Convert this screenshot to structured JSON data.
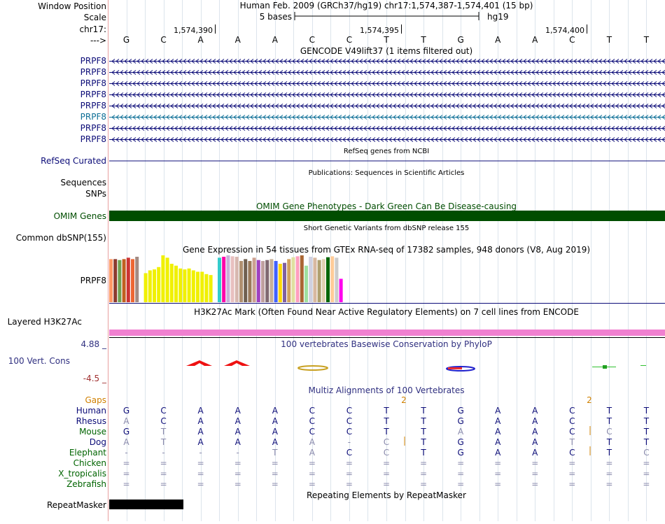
{
  "header": {
    "window_position_label": "Window Position",
    "scale_label": "Scale",
    "chrom_label": "chr17:",
    "strand_label": "--->",
    "assembly_text": "Human Feb. 2009 (GRCh37/hg19)   chr17:1,574,387-1,574,401 (15 bp)",
    "scale_text": "5 bases",
    "db_text": "hg19",
    "positions": [
      "1,574,390",
      "1,574,395",
      "1,574,400"
    ],
    "bases": [
      "G",
      "C",
      "A",
      "A",
      "A",
      "C",
      "C",
      "T",
      "T",
      "G",
      "A",
      "A",
      "C",
      "T",
      "T"
    ]
  },
  "gencode": {
    "title": "GENCODE V49lift37 (1 items filtered out)",
    "labels": [
      "PRPF8",
      "PRPF8",
      "PRPF8",
      "PRPF8",
      "PRPF8",
      "PRPF8",
      "PRPF8",
      "PRPF8"
    ],
    "colors": [
      "#0c0c78",
      "#0c0c78",
      "#0c0c78",
      "#0c0c78",
      "#0c0c78",
      "#0c6e96",
      "#0c0c78",
      "#0c0c78"
    ]
  },
  "refseq": {
    "title": "RefSeq genes from NCBI",
    "label": "RefSeq Curated",
    "color": "#0c0c78"
  },
  "publications": {
    "title": "Publications: Sequences in Scientific Articles",
    "label_sequences": "Sequences",
    "label_snps": "SNPs"
  },
  "omim": {
    "title": "OMIM Gene Phenotypes - Dark Green Can Be Disease-causing",
    "label": "OMIM Genes",
    "color": "#004d00"
  },
  "dbsnp": {
    "title": "Short Genetic Variants from dbSNP release 155",
    "label": "Common dbSNP(155)"
  },
  "gtex": {
    "title": "Gene Expression in 54 tissues from GTEx RNA-seq of 17382 samples, 948 donors (V8, Aug 2019)",
    "label": "PRPF8",
    "values": [
      0.92,
      0.92,
      0.9,
      0.92,
      0.95,
      0.92,
      0.97,
      0.95,
      0.62,
      0.68,
      0.7,
      0.75,
      1.0,
      0.95,
      0.82,
      0.78,
      0.72,
      0.7,
      0.72,
      0.68,
      0.65,
      0.65,
      0.6,
      0.58,
      0.62,
      0.95,
      0.97,
      1.0,
      0.98,
      0.97,
      0.88,
      0.92,
      0.88,
      0.95,
      0.9,
      0.88,
      0.9,
      0.92,
      0.88,
      0.82,
      0.84,
      0.92,
      0.96,
      0.98,
      1.0,
      0.78,
      0.97,
      0.95,
      0.9,
      0.92,
      0.96,
      0.98,
      0.95,
      0.5
    ],
    "colors": [
      "#ff9966",
      "#8c3a2e",
      "#70a050",
      "#c06020",
      "#cc3333",
      "#ee6633",
      "#a48a82",
      "#ffffff",
      "#f0f000",
      "#f0f000",
      "#f0f000",
      "#f0f000",
      "#f0f000",
      "#f0f000",
      "#f0f000",
      "#f0f000",
      "#f0f000",
      "#f0f000",
      "#f0f000",
      "#f0f000",
      "#f0f000",
      "#f0f000",
      "#f0f000",
      "#f0f000",
      "#ffffff",
      "#33cccc",
      "#ff00aa",
      "#c8b0d8",
      "#e8c0c0",
      "#d8b8b0",
      "#b09070",
      "#706050",
      "#9a7a5a",
      "#cca090",
      "#a040c0",
      "#c0a0a0",
      "#806870",
      "#c8b098",
      "#4060ff",
      "#ffd700",
      "#8060a0",
      "#d0a060",
      "#e0e0a0",
      "#ff9fbf",
      "#aa6633",
      "#a0e0a0",
      "#d0d0e0",
      "#d8b8a0",
      "#b0a070",
      "#e0d0b0",
      "#006400",
      "#ffcc99",
      "#cccccc",
      "#ff00ee"
    ]
  },
  "h3k27ac": {
    "title": "H3K27Ac Mark (Often Found Near Active Regulatory Elements) on 7 cell lines from ENCODE",
    "label": "Layered H3K27Ac",
    "color": "#f080d0"
  },
  "conservation": {
    "title": "100 vertebrates Basewise Conservation by PhyloP",
    "label": "100 Vert. Cons",
    "max_label": "4.88 _",
    "min_label": "-4.5 _"
  },
  "multiz": {
    "title": "Multiz Alignments of 100 Vertebrates",
    "gaps_label": "Gaps",
    "gap_markers": [
      "2",
      "2"
    ],
    "species": [
      {
        "name": "Human",
        "color": "#0c0c78",
        "bases": [
          "G",
          "C",
          "A",
          "A",
          "A",
          "C",
          "C",
          "T",
          "T",
          "G",
          "A",
          "A",
          "C",
          "T",
          "T"
        ]
      },
      {
        "name": "Rhesus",
        "color": "#0c0c78",
        "bases": [
          "A",
          "C",
          "A",
          "A",
          "A",
          "C",
          "C",
          "T",
          "T",
          "G",
          "A",
          "A",
          "C",
          "T",
          "T"
        ]
      },
      {
        "name": "Mouse",
        "color": "#006400",
        "bases": [
          "G",
          "T",
          "A",
          "A",
          "A",
          "C",
          "C",
          "T",
          "T",
          "A",
          "A",
          "A",
          "C",
          "C",
          "T"
        ]
      },
      {
        "name": "Dog",
        "color": "#0c0c78",
        "bases": [
          "A",
          "T",
          "A",
          "A",
          "A",
          "A",
          "-",
          "C",
          "T",
          "G",
          "A",
          "A",
          "T",
          "T",
          "T"
        ]
      },
      {
        "name": "Elephant",
        "color": "#006400",
        "bases": [
          "-",
          "-",
          "-",
          "-",
          "T",
          "A",
          "C",
          "C",
          "T",
          "G",
          "A",
          "A",
          "C",
          "T",
          "C"
        ]
      },
      {
        "name": "Chicken",
        "color": "#006400",
        "bases": [
          "=",
          "=",
          "=",
          "=",
          "=",
          "=",
          "=",
          "=",
          "=",
          "=",
          "=",
          "=",
          "=",
          "=",
          "="
        ]
      },
      {
        "name": "X_tropicalis",
        "color": "#006400",
        "bases": [
          "=",
          "=",
          "=",
          "=",
          "=",
          "=",
          "=",
          "=",
          "=",
          "=",
          "=",
          "=",
          "=",
          "=",
          "="
        ]
      },
      {
        "name": "Zebrafish",
        "color": "#006400",
        "bases": [
          "=",
          "=",
          "=",
          "=",
          "=",
          "=",
          "=",
          "=",
          "=",
          "=",
          "=",
          "=",
          "=",
          "=",
          "="
        ]
      }
    ],
    "light_cells": [
      [
        1,
        0
      ],
      [
        3,
        0
      ],
      [
        2,
        1
      ],
      [
        3,
        1
      ],
      [
        2,
        9
      ],
      [
        2,
        13
      ],
      [
        3,
        5
      ],
      [
        3,
        6
      ],
      [
        3,
        7
      ],
      [
        3,
        12
      ],
      [
        4,
        0
      ],
      [
        4,
        1
      ],
      [
        4,
        2
      ],
      [
        4,
        3
      ],
      [
        4,
        4
      ],
      [
        4,
        5
      ],
      [
        4,
        7
      ],
      [
        4,
        14
      ]
    ]
  },
  "repeatmasker": {
    "title": "Repeating Elements by RepeatMasker",
    "label": "RepeatMasker"
  }
}
